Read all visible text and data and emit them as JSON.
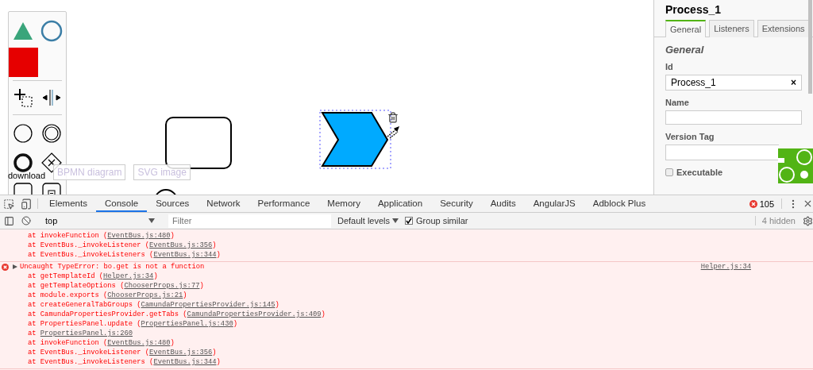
{
  "canvas": {
    "elements": [
      {
        "kind": "task",
        "selected": false
      },
      {
        "kind": "chevron",
        "selected": true
      },
      {
        "kind": "event",
        "selected": false
      }
    ]
  },
  "export": {
    "label": "download",
    "buttons": [
      {
        "label": "BPMN diagram",
        "disabled": true
      },
      {
        "label": "SVG image",
        "disabled": true
      }
    ]
  },
  "properties_panel": {
    "title": "Process_1",
    "tabs": [
      {
        "label": "General",
        "selected": true
      },
      {
        "label": "Listeners",
        "selected": false
      },
      {
        "label": "Extensions",
        "selected": false
      }
    ],
    "section": "General",
    "fields": [
      {
        "kind": "text",
        "label": "Id",
        "value": "Process_1",
        "clear": "×"
      },
      {
        "kind": "textarea",
        "label": "Name"
      },
      {
        "kind": "text",
        "label": "Version Tag"
      },
      {
        "kind": "checkbox",
        "label": "Executable",
        "checked": false
      }
    ]
  },
  "devtools": {
    "tabs": [
      {
        "label": "Elements",
        "selected": false
      },
      {
        "label": "Console",
        "selected": true
      },
      {
        "label": "Sources",
        "selected": false
      },
      {
        "label": "Network",
        "selected": false
      },
      {
        "label": "Performance",
        "selected": false
      },
      {
        "label": "Memory",
        "selected": false
      },
      {
        "label": "Application",
        "selected": false
      },
      {
        "label": "Security",
        "selected": false
      },
      {
        "label": "Audits",
        "selected": false
      },
      {
        "label": "AngularJS",
        "selected": false
      },
      {
        "label": "Adblock Plus",
        "selected": false
      }
    ],
    "error_count": "105",
    "toolbar": {
      "context": "top",
      "filter_placeholder": "Filter",
      "levels": "Default levels",
      "group_similar": {
        "label": "Group similar",
        "checked": true
      },
      "hidden": "4 hidden"
    },
    "console": [
      {
        "kind": "trace",
        "frames": [
          {
            "before": "at invokeFunction (",
            "link": "EventBus.js:480",
            "after": ")"
          },
          {
            "before": "at EventBus._invokeListener (",
            "link": "EventBus.js:356",
            "after": ")"
          },
          {
            "before": "at EventBus._invokeListeners (",
            "link": "EventBus.js:344",
            "after": ")"
          }
        ]
      },
      {
        "kind": "error",
        "message": "Uncaught TypeError: bo.get is not a function",
        "source": "Helper.js:34",
        "frames": [
          {
            "before": "at getTemplateId (",
            "link": "Helper.js:34",
            "after": ")"
          },
          {
            "before": "at getTemplateOptions (",
            "link": "ChooserProps.js:77",
            "after": ")"
          },
          {
            "before": "at module.exports (",
            "link": "ChooserProps.js:21",
            "after": ")"
          },
          {
            "before": "at createGeneralTabGroups (",
            "link": "CamundaPropertiesProvider.js:145",
            "after": ")"
          },
          {
            "before": "at CamundaPropertiesProvider.getTabs (",
            "link": "CamundaPropertiesProvider.js:409",
            "after": ")"
          },
          {
            "before": "at PropertiesPanel.update (",
            "link": "PropertiesPanel.js:430",
            "after": ")"
          },
          {
            "before": "at ",
            "link": "PropertiesPanel.js:260"
          },
          {
            "before": "at invokeFunction (",
            "link": "EventBus.js:480",
            "after": ")"
          },
          {
            "before": "at EventBus._invokeListener (",
            "link": "EventBus.js:356",
            "after": ")"
          },
          {
            "before": "at EventBus._invokeListeners (",
            "link": "EventBus.js:344",
            "after": ")"
          }
        ]
      }
    ]
  }
}
